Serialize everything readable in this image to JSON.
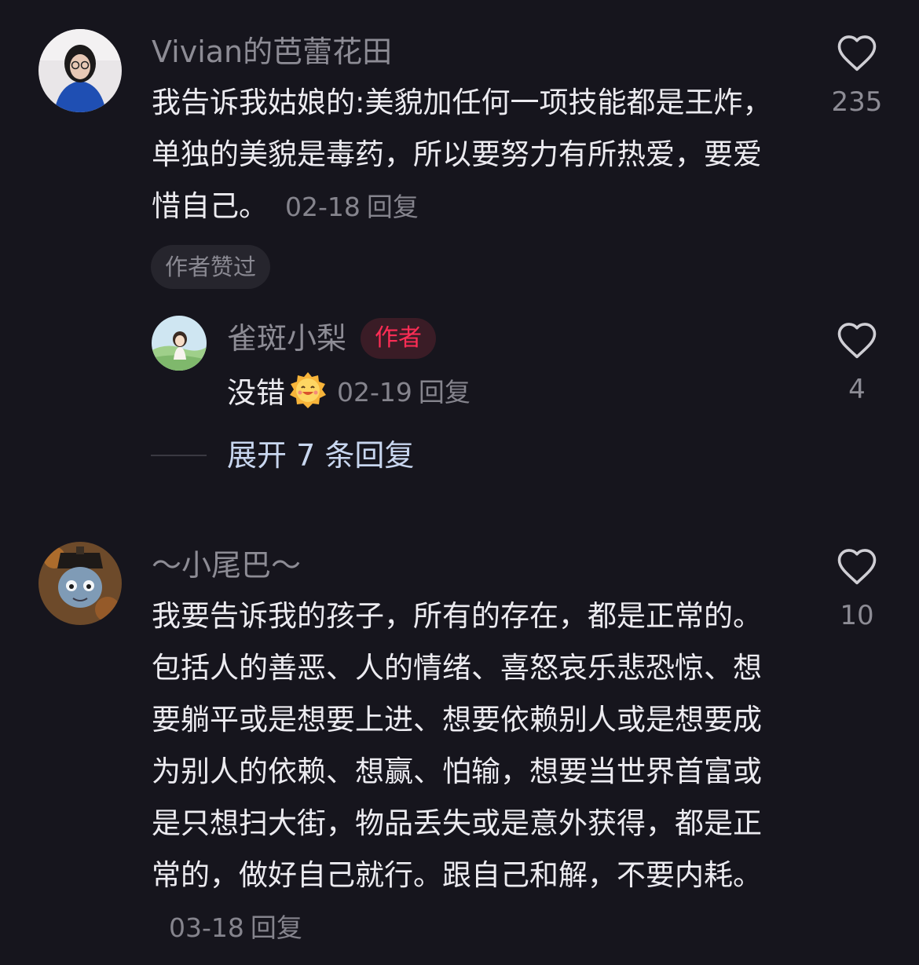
{
  "comments": [
    {
      "username": "Vivian的芭蕾花田",
      "text": "我告诉我姑娘的:美貌加任何一项技能都是王炸，单独的美貌是毒药，所以要努力有所热爱，要爱惜自己。",
      "date": "02-18",
      "reply_label": "回复",
      "like_count": "235",
      "author_liked_badge": "作者赞过",
      "reply": {
        "username": "雀斑小梨",
        "author_badge": "作者",
        "text": "没错",
        "emoji": "smiling-face-emoji",
        "date": "02-19",
        "reply_label": "回复",
        "like_count": "4"
      },
      "expand_label": "展开 7 条回复"
    },
    {
      "username": "～小尾巴～",
      "text": "我要告诉我的孩子，所有的存在，都是正常的。包括人的善恶、人的情绪、喜怒哀乐悲恐惊、想要躺平或是想要上进、想要依赖别人或是想要成为别人的依赖、想赢、怕输，想要当世界首富或是只想扫大街，物品丢失或是意外获得，都是正常的，做好自己就行。跟自己和解，不要内耗。",
      "date": "03-18",
      "reply_label": "回复",
      "like_count": "10"
    }
  ],
  "colors": {
    "background": "#16151d",
    "text": "#ecebf0",
    "muted": "#8d8c95",
    "author_badge": "#ff2d55",
    "expand_link": "#c8d6ef"
  },
  "icons": [
    "heart-outline-icon"
  ]
}
